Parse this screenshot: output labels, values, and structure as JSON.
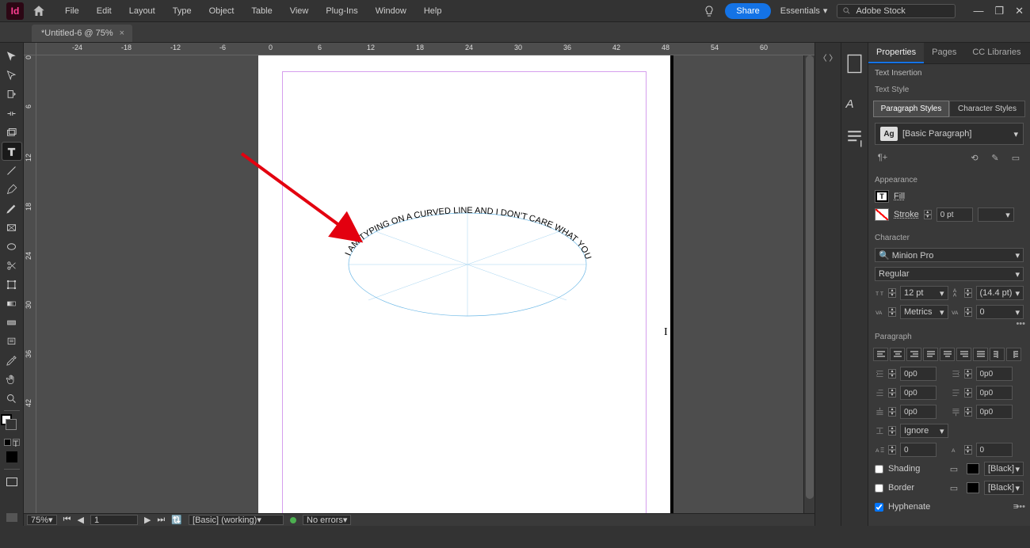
{
  "app": {
    "logo_text": "Id"
  },
  "menu": {
    "items": [
      "File",
      "Edit",
      "Layout",
      "Type",
      "Object",
      "Table",
      "View",
      "Plug-Ins",
      "Window",
      "Help"
    ]
  },
  "topright": {
    "share": "Share",
    "workspace": "Essentials",
    "stock_placeholder": "Adobe Stock"
  },
  "doc": {
    "tab_title": "*Untitled-6 @ 75%"
  },
  "hruler": [
    "-24",
    "-18",
    "-12",
    "-6",
    "0",
    "6",
    "12",
    "18",
    "24",
    "30",
    "36",
    "42",
    "48",
    "54",
    "60"
  ],
  "vruler": [
    "0",
    "6",
    "12",
    "18",
    "24",
    "30",
    "36",
    "42"
  ],
  "canvas_text": "I AM TYPING ON A CURVED LINE AND I DON'T CARE WHAT YOU THINK!",
  "status": {
    "zoom": "75%",
    "page": "1",
    "profile": "[Basic] (working)",
    "errors": "No errors"
  },
  "panel": {
    "tabs": [
      "Properties",
      "Pages",
      "CC Libraries"
    ],
    "section1": "Text Insertion",
    "section2": "Text Style",
    "style_tabs": [
      "Paragraph Styles",
      "Character Styles"
    ],
    "style_name": "[Basic Paragraph]",
    "appearance_hdr": "Appearance",
    "fill_label": "Fill",
    "stroke_label": "Stroke",
    "stroke_val": "0 pt",
    "character_hdr": "Character",
    "font": "Minion Pro",
    "font_style": "Regular",
    "font_size": "12 pt",
    "leading": "(14.4 pt)",
    "kerning": "Metrics",
    "tracking": "0",
    "paragraph_hdr": "Paragraph",
    "indent_left": "0p0",
    "indent_right": "0p0",
    "first_line": "0p0",
    "last_line": "0p0",
    "space_before": "0p0",
    "space_after": "0p0",
    "auto_leading": "Ignore",
    "dropcap_lines": "0",
    "dropcap_chars": "0",
    "shading": "Shading",
    "shading_color": "[Black]",
    "border": "Border",
    "border_color": "[Black]",
    "hyphenate": "Hyphenate"
  }
}
